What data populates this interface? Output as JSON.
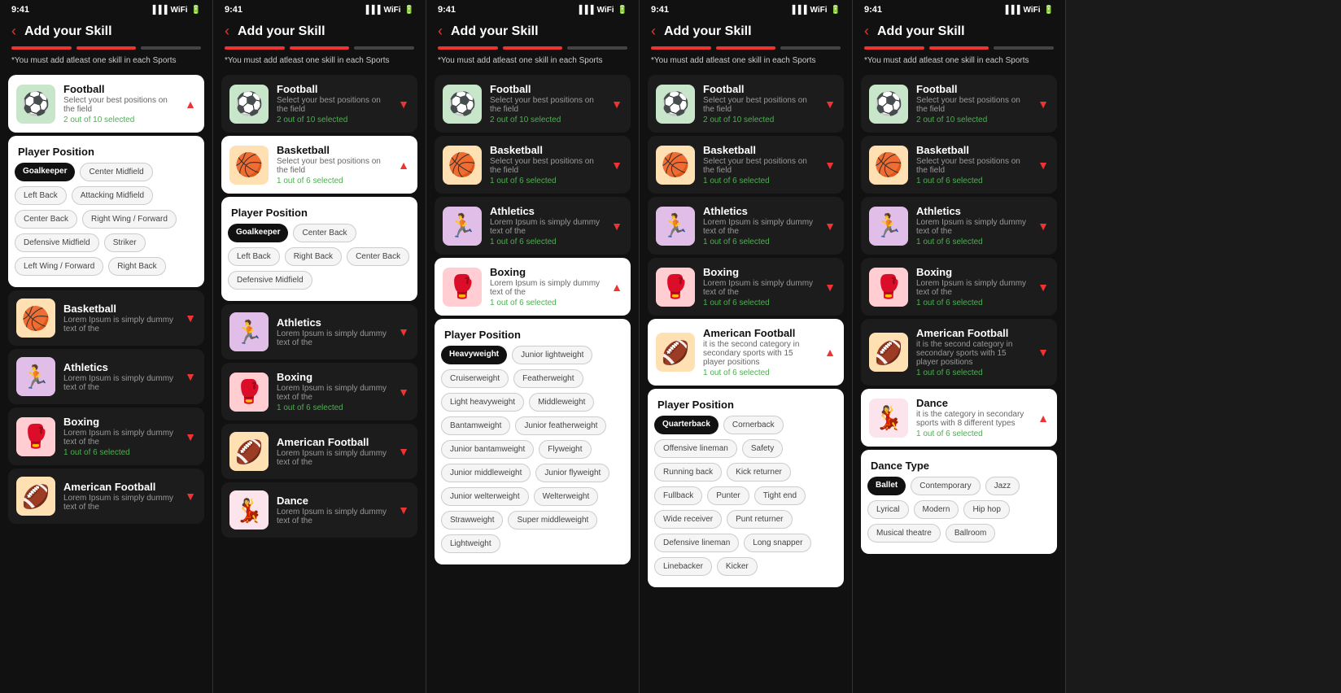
{
  "screens": [
    {
      "id": "screen1",
      "time": "9:41",
      "title": "Add your Skill",
      "warning": "*You must add atleast one skill in each Sports",
      "progress": [
        1,
        1,
        0
      ],
      "sports": [
        {
          "name": "Football",
          "desc": "Select your best positions on the field",
          "selected": "2 out of 10 selected",
          "icon": "⚽",
          "iconBg": "football-bg",
          "expanded": true,
          "chevron": "▲"
        },
        {
          "name": "Basketball",
          "desc": "Lorem Ipsum is simply dummy text of the",
          "selected": "",
          "icon": "🏀",
          "iconBg": "basketball-bg",
          "expanded": false,
          "chevron": "▼"
        },
        {
          "name": "Athletics",
          "desc": "Lorem Ipsum is simply dummy text of the",
          "selected": "",
          "icon": "🏃",
          "iconBg": "athletics-bg",
          "expanded": false,
          "chevron": "▼"
        },
        {
          "name": "Boxing",
          "desc": "Lorem Ipsum is simply dummy text of the",
          "selected": "1 out of 6 selected",
          "icon": "🥊",
          "iconBg": "boxing-bg",
          "expanded": false,
          "chevron": "▼"
        },
        {
          "name": "American Football",
          "desc": "Lorem Ipsum is simply dummy text of the",
          "selected": "",
          "icon": "🏈",
          "iconBg": "american-football-bg",
          "expanded": false,
          "chevron": "▼"
        }
      ],
      "playerPositionLabel": "Player Position",
      "tags": [
        {
          "label": "Goalkeeper",
          "active": true
        },
        {
          "label": "Center Midfield",
          "active": false
        },
        {
          "label": "Left Back",
          "active": false
        },
        {
          "label": "Attacking Midfield",
          "active": false
        },
        {
          "label": "Center Back",
          "active": false
        },
        {
          "label": "Right Wing / Forward",
          "active": false
        },
        {
          "label": "Defensive Midfield",
          "active": false
        },
        {
          "label": "Striker",
          "active": false
        },
        {
          "label": "Left Wing / Forward",
          "active": false
        },
        {
          "label": "Right Back",
          "active": false
        }
      ]
    },
    {
      "id": "screen2",
      "time": "9:41",
      "title": "Add your Skill",
      "warning": "*You must add atleast one skill in each Sports",
      "progress": [
        1,
        1,
        0
      ],
      "sports": [
        {
          "name": "Football",
          "desc": "Select your best positions on the field",
          "selected": "2 out of 10 selected",
          "icon": "⚽",
          "iconBg": "football-bg",
          "expanded": false,
          "chevron": "▼"
        },
        {
          "name": "Basketball",
          "desc": "Select your best positions on the field",
          "selected": "1 out of 6 selected",
          "icon": "🏀",
          "iconBg": "basketball-bg",
          "expanded": true,
          "chevron": "▲"
        },
        {
          "name": "Athletics",
          "desc": "Lorem Ipsum is simply dummy text of the",
          "selected": "",
          "icon": "🏃",
          "iconBg": "athletics-bg",
          "expanded": false,
          "chevron": "▼"
        },
        {
          "name": "Boxing",
          "desc": "Lorem Ipsum is simply dummy text of the",
          "selected": "1 out of 6 selected",
          "icon": "🥊",
          "iconBg": "boxing-bg",
          "expanded": false,
          "chevron": "▼"
        },
        {
          "name": "American Football",
          "desc": "Lorem Ipsum is simply dummy text of the",
          "selected": "",
          "icon": "🏈",
          "iconBg": "american-football-bg",
          "expanded": false,
          "chevron": "▼"
        },
        {
          "name": "Dance",
          "desc": "Lorem Ipsum is simply dummy text of the",
          "selected": "",
          "icon": "💃",
          "iconBg": "dance-bg",
          "expanded": false,
          "chevron": "▼"
        }
      ],
      "playerPositionLabel": "Player Position",
      "tags": [
        {
          "label": "Goalkeeper",
          "active": true
        },
        {
          "label": "Center Back",
          "active": false
        },
        {
          "label": "Left Back",
          "active": false
        },
        {
          "label": "Right Back",
          "active": false
        },
        {
          "label": "Center Back",
          "active": false
        },
        {
          "label": "Defensive Midfield",
          "active": false
        }
      ]
    },
    {
      "id": "screen3",
      "time": "9:41",
      "title": "Add your Skill",
      "warning": "*You must add atleast one skill in each Sports",
      "progress": [
        1,
        1,
        0
      ],
      "sports": [
        {
          "name": "Football",
          "desc": "Select your best positions on the field",
          "selected": "2 out of 10 selected",
          "icon": "⚽",
          "iconBg": "football-bg",
          "expanded": false,
          "chevron": "▼"
        },
        {
          "name": "Basketball",
          "desc": "Select your best positions on the field",
          "selected": "1 out of 6 selected",
          "icon": "🏀",
          "iconBg": "basketball-bg",
          "expanded": false,
          "chevron": "▼"
        },
        {
          "name": "Athletics",
          "desc": "Lorem Ipsum is simply dummy text of the",
          "selected": "1 out of 6 selected",
          "icon": "🏃",
          "iconBg": "athletics-bg",
          "expanded": false,
          "chevron": "▼"
        },
        {
          "name": "Boxing",
          "desc": "Lorem Ipsum is simply dummy text of the",
          "selected": "1 out of 6 selected",
          "icon": "🥊",
          "iconBg": "boxing-bg",
          "expanded": true,
          "chevron": "▲"
        }
      ],
      "playerPositionLabel": "Player Position",
      "tags": [
        {
          "label": "Heavyweight",
          "active": true
        },
        {
          "label": "Junior lightweight",
          "active": false
        },
        {
          "label": "Cruiserweight",
          "active": false
        },
        {
          "label": "Featherweight",
          "active": false
        },
        {
          "label": "Light heavyweight",
          "active": false
        },
        {
          "label": "Middleweight",
          "active": false
        },
        {
          "label": "Bantamweight",
          "active": false
        },
        {
          "label": "Junior featherweight",
          "active": false
        },
        {
          "label": "Junior bantamweight",
          "active": false
        },
        {
          "label": "Flyweight",
          "active": false
        },
        {
          "label": "Junior middleweight",
          "active": false
        },
        {
          "label": "Junior flyweight",
          "active": false
        },
        {
          "label": "Junior welterweight",
          "active": false
        },
        {
          "label": "Welterweight",
          "active": false
        },
        {
          "label": "Strawweight",
          "active": false
        },
        {
          "label": "Super middleweight",
          "active": false
        },
        {
          "label": "Lightweight",
          "active": false
        }
      ]
    },
    {
      "id": "screen4",
      "time": "9:41",
      "title": "Add your Skill",
      "warning": "*You must add atleast one skill in each Sports",
      "progress": [
        1,
        1,
        0
      ],
      "sports": [
        {
          "name": "Football",
          "desc": "Select your best positions on the field",
          "selected": "2 out of 10 selected",
          "icon": "⚽",
          "iconBg": "football-bg",
          "expanded": false,
          "chevron": "▼"
        },
        {
          "name": "Basketball",
          "desc": "Select your best positions on the field",
          "selected": "1 out of 6 selected",
          "icon": "🏀",
          "iconBg": "basketball-bg",
          "expanded": false,
          "chevron": "▼"
        },
        {
          "name": "Athletics",
          "desc": "Lorem Ipsum is simply dummy text of the",
          "selected": "1 out of 6 selected",
          "icon": "🏃",
          "iconBg": "athletics-bg",
          "expanded": false,
          "chevron": "▼"
        },
        {
          "name": "Boxing",
          "desc": "Lorem Ipsum is simply dummy text of the",
          "selected": "1 out of 6 selected",
          "icon": "🥊",
          "iconBg": "boxing-bg",
          "expanded": false,
          "chevron": "▼"
        },
        {
          "name": "American Football",
          "desc": "it is the second category in secondary sports with 15 player positions",
          "selected": "1 out of 6 selected",
          "icon": "🏈",
          "iconBg": "american-football-bg",
          "expanded": true,
          "chevron": "▲"
        }
      ],
      "playerPositionLabel": "Player Position",
      "tags": [
        {
          "label": "Quarterback",
          "active": true
        },
        {
          "label": "Cornerback",
          "active": false
        },
        {
          "label": "Offensive lineman",
          "active": false
        },
        {
          "label": "Safety",
          "active": false
        },
        {
          "label": "Running back",
          "active": false
        },
        {
          "label": "Kick returner",
          "active": false
        },
        {
          "label": "Fullback",
          "active": false
        },
        {
          "label": "Punter",
          "active": false
        },
        {
          "label": "Tight end",
          "active": false
        },
        {
          "label": "Wide receiver",
          "active": false
        },
        {
          "label": "Punt returner",
          "active": false
        },
        {
          "label": "Defensive lineman",
          "active": false
        },
        {
          "label": "Long snapper",
          "active": false
        },
        {
          "label": "Linebacker",
          "active": false
        },
        {
          "label": "Kicker",
          "active": false
        }
      ]
    },
    {
      "id": "screen5",
      "time": "9:41",
      "title": "Add your Skill",
      "warning": "*You must add atleast one skill in each Sports",
      "progress": [
        1,
        1,
        0
      ],
      "sports": [
        {
          "name": "Football",
          "desc": "Select your best positions on the field",
          "selected": "2 out of 10 selected",
          "icon": "⚽",
          "iconBg": "football-bg",
          "expanded": false,
          "chevron": "▼"
        },
        {
          "name": "Basketball",
          "desc": "Select your best positions on the field",
          "selected": "1 out of 6 selected",
          "icon": "🏀",
          "iconBg": "basketball-bg",
          "expanded": false,
          "chevron": "▼"
        },
        {
          "name": "Athletics",
          "desc": "Lorem Ipsum is simply dummy text of the",
          "selected": "1 out of 6 selected",
          "icon": "🏃",
          "iconBg": "athletics-bg",
          "expanded": false,
          "chevron": "▼"
        },
        {
          "name": "Boxing",
          "desc": "Lorem Ipsum is simply dummy text of the",
          "selected": "1 out of 6 selected",
          "icon": "🥊",
          "iconBg": "boxing-bg",
          "expanded": false,
          "chevron": "▼"
        },
        {
          "name": "American Football",
          "desc": "it is the second category in secondary sports with 15 player positions",
          "selected": "1 out of 6 selected",
          "icon": "🏈",
          "iconBg": "american-football-bg",
          "expanded": false,
          "chevron": "▼"
        },
        {
          "name": "Dance",
          "desc": "it is the category in secondary sports with 8 different types",
          "selected": "1 out of 6 selected",
          "icon": "💃",
          "iconBg": "dance-bg",
          "expanded": true,
          "chevron": "▲"
        }
      ],
      "danceTypeLabel": "Dance Type",
      "tags": [
        {
          "label": "Ballet",
          "active": true
        },
        {
          "label": "Contemporary",
          "active": false
        },
        {
          "label": "Jazz",
          "active": false
        },
        {
          "label": "Lyrical",
          "active": false
        },
        {
          "label": "Modern",
          "active": false
        },
        {
          "label": "Hip hop",
          "active": false
        },
        {
          "label": "Musical theatre",
          "active": false
        },
        {
          "label": "Ballroom",
          "active": false
        }
      ]
    }
  ]
}
